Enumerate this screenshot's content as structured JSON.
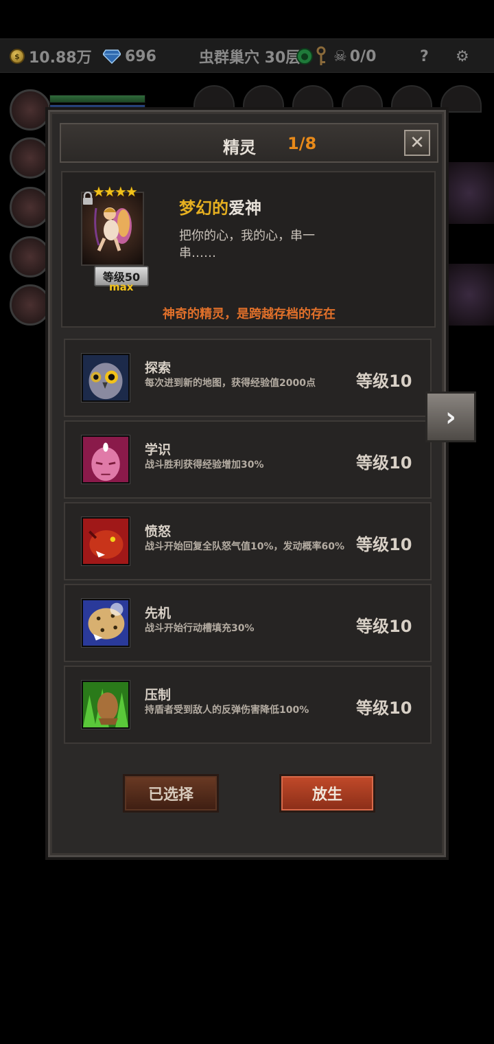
{
  "topbar": {
    "gold": "10.88万",
    "gems": "696",
    "floor": "虫群巢穴 30层",
    "kills": "0/0",
    "help": "?"
  },
  "dialog": {
    "title": "精灵",
    "count": "1/8",
    "spirit": {
      "name_prefix": "梦幻的",
      "name_suffix": "爱神",
      "description": "把你的心，我的心，串一串……",
      "level": "等级50",
      "level_max": "max",
      "stars": "★★★★",
      "note": "神奇的精灵，是跨越存档的存在"
    },
    "skills": [
      {
        "name": "探索",
        "desc": "每次进到新的地图，获得经验值2000点",
        "level": "等级10",
        "icon": "owl-icon"
      },
      {
        "name": "学识",
        "desc": "战斗胜利获得经验增加30%",
        "level": "等级10",
        "icon": "third-eye-icon"
      },
      {
        "name": "愤怒",
        "desc": "战斗开始回复全队怒气值10%，发动概率60%",
        "level": "等级10",
        "icon": "panther-icon"
      },
      {
        "name": "先机",
        "desc": "战斗开始行动槽填充30%",
        "level": "等级10",
        "icon": "leopard-icon"
      },
      {
        "name": "压制",
        "desc": "持盾者受到敌人的反弹伤害降低100%",
        "level": "等级10",
        "icon": "lion-paw-icon"
      }
    ],
    "buttons": {
      "selected": "已选择",
      "release": "放生"
    }
  },
  "colors": {
    "accent_orange": "#e88a1a",
    "name_gold": "#e6b020",
    "note_orange": "#e0702a",
    "release_red": "#c24a2a"
  }
}
